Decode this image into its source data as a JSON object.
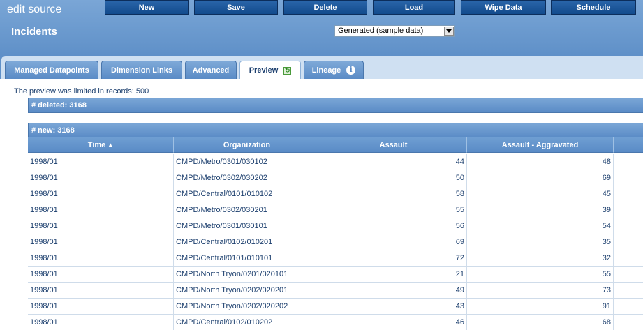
{
  "app": {
    "title": "edit source",
    "page_title": "Incidents"
  },
  "toolbar": {
    "buttons": [
      {
        "label": "New"
      },
      {
        "label": "Save"
      },
      {
        "label": "Delete"
      },
      {
        "label": "Load"
      },
      {
        "label": "Wipe Data"
      },
      {
        "label": "Schedule"
      }
    ]
  },
  "source_select": {
    "value": "Generated (sample data)"
  },
  "tabs": [
    {
      "label": "Managed Datapoints"
    },
    {
      "label": "Dimension Links"
    },
    {
      "label": "Advanced"
    },
    {
      "label": "Preview",
      "icon": "refresh-icon",
      "active": true
    },
    {
      "label": "Lineage",
      "icon": "info-icon"
    }
  ],
  "preview": {
    "notice": "The preview was limited in records: 500",
    "deleted_group": "# deleted: 3168",
    "new_group": "# new: 3168",
    "columns": [
      "Time",
      "Organization",
      "Assault",
      "Assault - Aggravated"
    ],
    "rows": [
      [
        "1998/01",
        "CMPD/Metro/0301/030102",
        "44",
        "48"
      ],
      [
        "1998/01",
        "CMPD/Metro/0302/030202",
        "50",
        "69"
      ],
      [
        "1998/01",
        "CMPD/Central/0101/010102",
        "58",
        "45"
      ],
      [
        "1998/01",
        "CMPD/Metro/0302/030201",
        "55",
        "39"
      ],
      [
        "1998/01",
        "CMPD/Metro/0301/030101",
        "56",
        "54"
      ],
      [
        "1998/01",
        "CMPD/Central/0102/010201",
        "69",
        "35"
      ],
      [
        "1998/01",
        "CMPD/Central/0101/010101",
        "72",
        "32"
      ],
      [
        "1998/01",
        "CMPD/North Tryon/0201/020101",
        "21",
        "55"
      ],
      [
        "1998/01",
        "CMPD/North Tryon/0202/020201",
        "49",
        "73"
      ],
      [
        "1998/01",
        "CMPD/North Tryon/0202/020202",
        "43",
        "91"
      ],
      [
        "1998/01",
        "CMPD/Central/0102/010202",
        "46",
        "68"
      ]
    ]
  }
}
